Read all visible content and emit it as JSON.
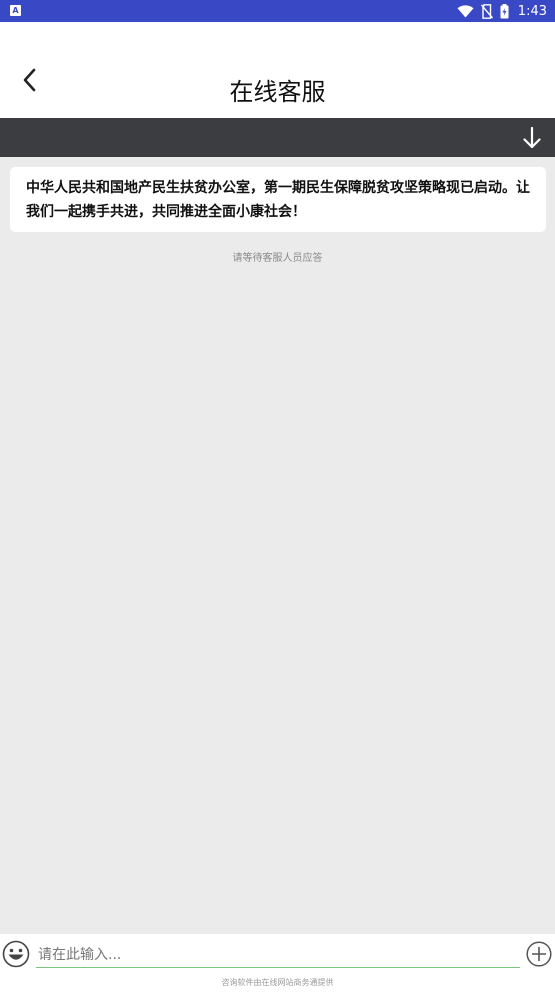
{
  "status_bar": {
    "time": "1:43",
    "app_badge": "A",
    "icons": [
      "wifi-icon",
      "no-sim-icon",
      "battery-icon"
    ]
  },
  "header": {
    "title": "在线客服",
    "back_icon": "chevron-left-icon"
  },
  "toolbar": {
    "scroll_down_icon": "arrow-down-icon",
    "background": "#3b3d40"
  },
  "chat": {
    "notice": "中华人民共和国地产民生扶贫办公室，第一期民生保障脱贫攻坚策略现已启动。让我们一起携手共进，共同推进全面小康社会！",
    "wait_hint": "请等待客服人员应答"
  },
  "input_bar": {
    "placeholder": "请在此输入...",
    "emoji_icon": "smiley-icon",
    "plus_icon": "plus-circle-icon",
    "provider_text": "咨询软件由在线网站商务通提供",
    "underline_color": "#7dc47d"
  },
  "colors": {
    "status_bar": "#3949c5",
    "background": "#ebebeb"
  }
}
